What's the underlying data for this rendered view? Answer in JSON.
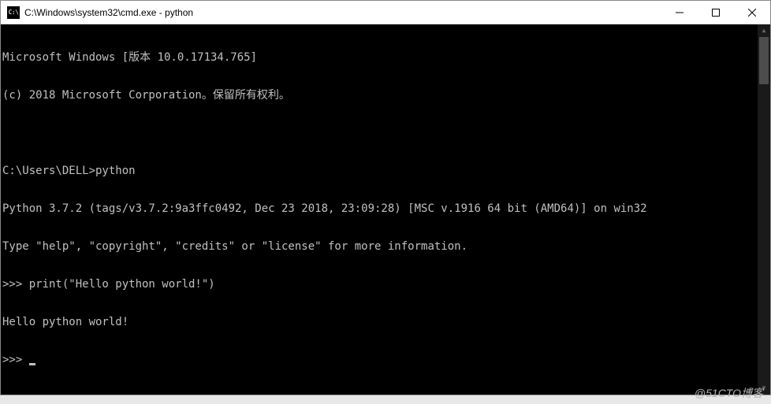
{
  "window": {
    "icon_label": "C:\\",
    "title": "C:\\Windows\\system32\\cmd.exe - python"
  },
  "terminal": {
    "lines": [
      "Microsoft Windows [版本 10.0.17134.765]",
      "(c) 2018 Microsoft Corporation。保留所有权利。",
      "",
      "C:\\Users\\DELL>python",
      "Python 3.7.2 (tags/v3.7.2:9a3ffc0492, Dec 23 2018, 23:09:28) [MSC v.1916 64 bit (AMD64)] on win32",
      "Type \"help\", \"copyright\", \"credits\" or \"license\" for more information.",
      ">>> print(\"Hello python world!\")",
      "Hello python world!",
      ">>> "
    ]
  },
  "watermark": "@51CTO博客"
}
